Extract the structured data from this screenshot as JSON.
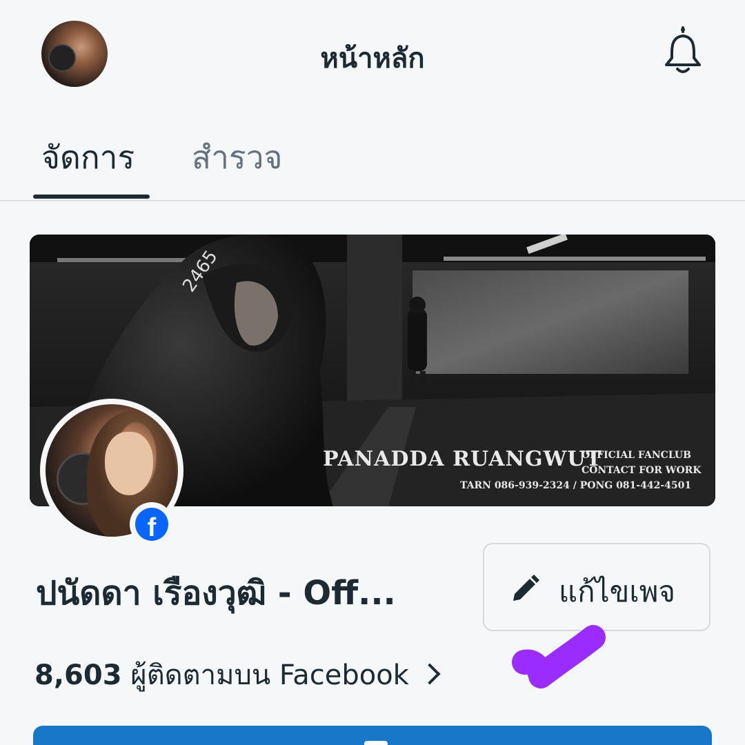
{
  "header": {
    "title": "หน้าหลัก"
  },
  "tabs": [
    {
      "label": "จัดการ",
      "active": true
    },
    {
      "label": "สำรวจ",
      "active": false
    }
  ],
  "cover": {
    "name": "PANADDA RUANGWUT",
    "line1": "OFFICIAL FANCLUB",
    "line2": "CONTACT FOR WORK",
    "contact": "TARN 086-939-2324 / PONG 081-442-4501",
    "hood_number": "2465"
  },
  "page": {
    "name": "ปนัดดา เรืองวุฒิ - Off...",
    "edit_label": "แก้ไขเพจ",
    "followers_count": "8,603",
    "followers_label": "ผู้ติดตามบน Facebook"
  },
  "colors": {
    "text": "#1c2b33",
    "muted": "#65737e",
    "facebook_blue": "#0866ff",
    "annotation_purple": "#9b2cff"
  }
}
